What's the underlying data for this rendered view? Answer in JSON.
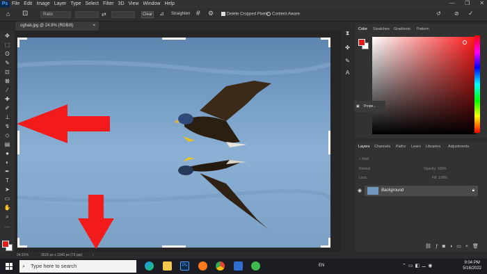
{
  "menubar": {
    "logo": "Ps",
    "items": [
      "File",
      "Edit",
      "Image",
      "Layer",
      "Type",
      "Select",
      "Filter",
      "3D",
      "View",
      "Window",
      "Help"
    ],
    "window_controls": [
      "—",
      "❐",
      "✕"
    ]
  },
  "options": {
    "ratio_label": "Ratio",
    "clear_label": "Clear",
    "straighten_label": "Straighten",
    "delete_cropped_label": "Delete Cropped Pixels",
    "content_aware_label": "Content-Aware"
  },
  "document": {
    "tab_title": "oghab.jpg @ 24.9% (RGB/8)",
    "zoom": "24.91%",
    "dimensions": "3525 px x 2343 px (72 ppi)"
  },
  "color_panel": {
    "tabs": [
      "Color",
      "Swatches",
      "Gradients",
      "Pattern"
    ],
    "foreground": "#e11b1b",
    "background": "#ffffff"
  },
  "props_panel": {
    "label": "Prope..."
  },
  "layers_panel": {
    "tabs": [
      "Layers",
      "Channels",
      "Paths",
      "Learn",
      "Libraries",
      "Adjustments"
    ],
    "kind_label": "Kind",
    "blend_mode": "Normal",
    "opacity_label": "Opacity:",
    "opacity_value": "100%",
    "lock_label": "Lock:",
    "fill_label": "Fill:",
    "fill_value": "100%",
    "layer_name": "Background"
  },
  "taskbar": {
    "search_placeholder": "Type here to search",
    "language": "EN",
    "time": "9:04 PM",
    "date": "5/16/2022"
  }
}
